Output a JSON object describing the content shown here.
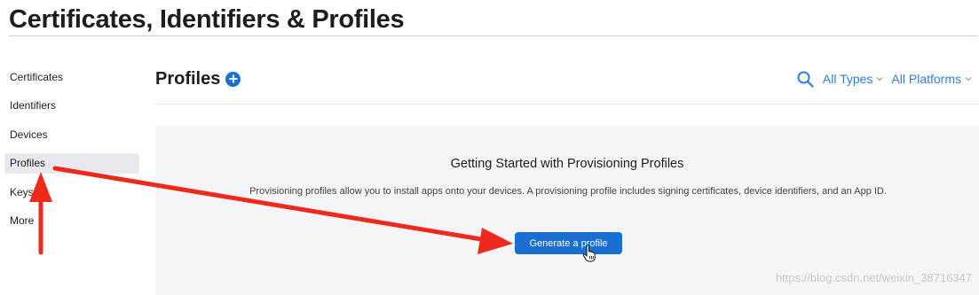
{
  "page": {
    "title": "Certificates, Identifiers & Profiles"
  },
  "sidebar": {
    "items": [
      {
        "label": "Certificates",
        "active": false
      },
      {
        "label": "Identifiers",
        "active": false
      },
      {
        "label": "Devices",
        "active": false
      },
      {
        "label": "Profiles",
        "active": true
      },
      {
        "label": "Keys",
        "active": false
      },
      {
        "label": "More",
        "active": false
      }
    ]
  },
  "header": {
    "title": "Profiles",
    "add_icon": "plus-circle-icon",
    "search_icon": "search-icon",
    "type_filter": "All Types",
    "platform_filter": "All Platforms"
  },
  "empty_state": {
    "heading": "Getting Started with Provisioning Profiles",
    "description": "Provisioning profiles allow you to install apps onto your devices. A provisioning profile includes signing certificates, device identifiers, and an App ID.",
    "button_label": "Generate a profile"
  },
  "watermark": "https://blog.csdn.net/weixin_38716347",
  "colors": {
    "accent": "#1b6fd0",
    "link": "#2f7ed8",
    "annotation_arrow": "#ee2a1e"
  }
}
